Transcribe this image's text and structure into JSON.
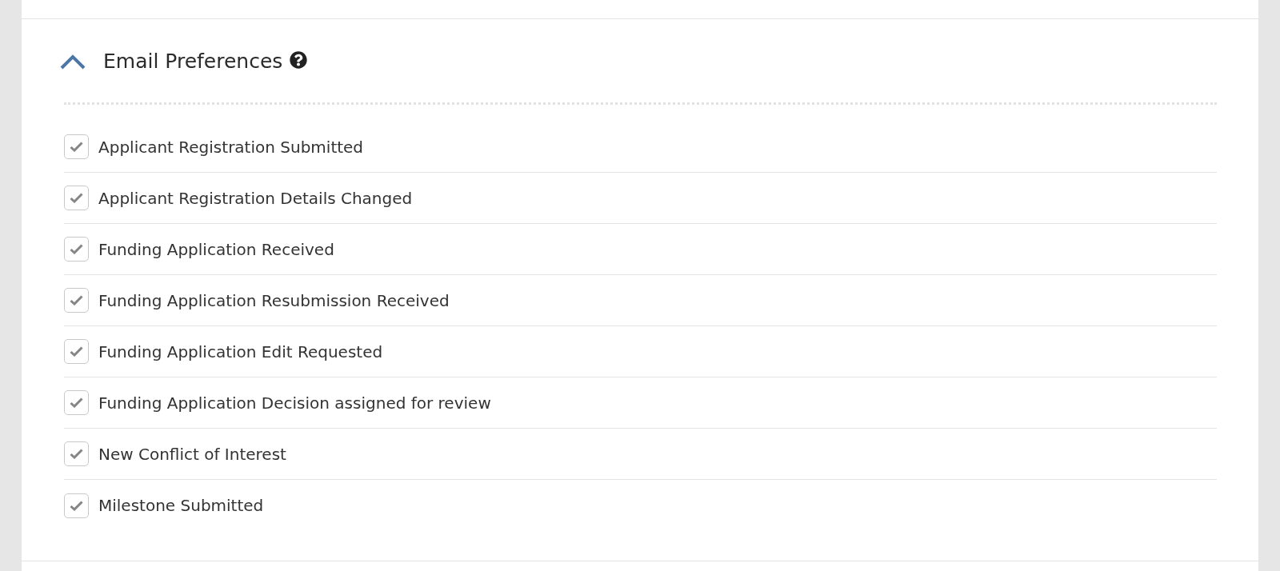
{
  "section": {
    "title": "Email Preferences",
    "expanded": true
  },
  "preferences": [
    {
      "label": "Applicant Registration Submitted",
      "checked": true
    },
    {
      "label": "Applicant Registration Details Changed",
      "checked": true
    },
    {
      "label": "Funding Application Received",
      "checked": true
    },
    {
      "label": "Funding Application Resubmission Received",
      "checked": true
    },
    {
      "label": "Funding Application Edit Requested",
      "checked": true
    },
    {
      "label": "Funding Application Decision assigned for review",
      "checked": true
    },
    {
      "label": "New Conflict of Interest",
      "checked": true
    },
    {
      "label": "Milestone Submitted",
      "checked": true
    }
  ]
}
